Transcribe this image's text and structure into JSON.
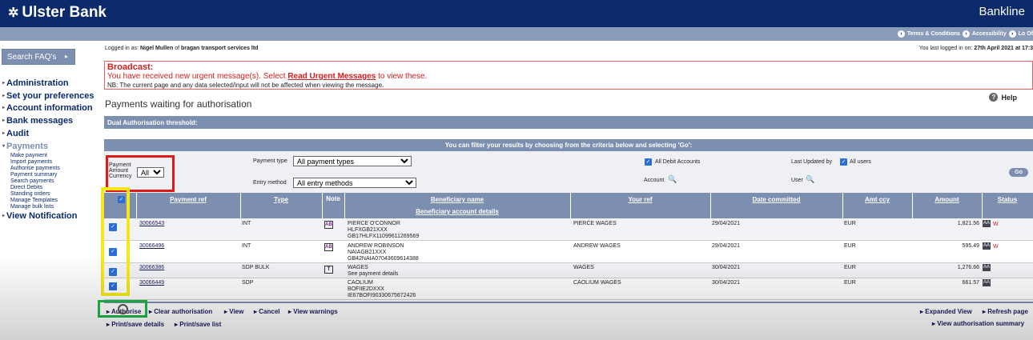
{
  "header": {
    "brand": "Ulster Bank",
    "product": "Bankline"
  },
  "top_links": [
    "Terms & Conditions",
    "Accessibility",
    "Lo Of"
  ],
  "sidebar": {
    "faq_label": "Search FAQ's",
    "items": [
      {
        "label": "Administration"
      },
      {
        "label": "Set your preferences"
      },
      {
        "label": "Account information"
      },
      {
        "label": "Bank messages"
      },
      {
        "label": "Audit"
      },
      {
        "label": "Payments"
      }
    ],
    "payments_sub": [
      "Make payment",
      "Import payments",
      "Authorise payments",
      "Payment summary",
      "Search payments",
      "Direct Debits",
      "Standing orders",
      "Manage Templates",
      "Manage bulk lists"
    ],
    "view_notification": "View Notification"
  },
  "session": {
    "logged_prefix": "Logged in as:",
    "user": "Nigel Mullen",
    "of_text": "of",
    "company": "bragan transport services ltd",
    "last_prefix": "You last logged in on:",
    "last_time": "27th April 2021 at 17:3"
  },
  "broadcast": {
    "title": "Broadcast:",
    "msg_pre": "You have received new urgent message(s). Select",
    "msg_link": "Read Urgent Messages",
    "msg_post": "to view these.",
    "nb": "NB: The current page and any data selected/input will not be affected when viewing the message."
  },
  "page": {
    "title": "Payments waiting for authorisation",
    "help": "Help"
  },
  "dual_threshold": "Dual Authorisation threshold:",
  "filter_bar": "You can filter your results by choosing from the criteria below and selecting 'Go':",
  "filters": {
    "amount_currency_label_1": "Payment",
    "amount_currency_label_2": "Amount",
    "amount_currency_label_3": "Currency",
    "amount_currency_value": "All",
    "payment_type_label": "Payment type",
    "payment_type_value": "All payment types",
    "entry_method_label": "Entry method",
    "entry_method_value": "All entry methods",
    "all_debit_accounts": "All Debit Accounts",
    "account_label": "Account",
    "last_updated_label": "Last Updated by",
    "all_users": "All users",
    "user_label": "User",
    "go": "Go"
  },
  "table": {
    "headers": {
      "payment_ref": "Payment ref",
      "type": "Type",
      "note": "Note",
      "beneficiary": "Beneficiary name",
      "beneficiary_details": "Beneficiary account details",
      "your_ref": "Your ref",
      "date": "Date committed",
      "amt_ccy": "Amt ccy",
      "amount": "Amount",
      "status": "Status"
    },
    "rows": [
      {
        "ref": "30066543",
        "type": "INT",
        "note": "AB",
        "ben1": "PIERCE O'CONNOR",
        "ben2": "HLFXGB21XXX",
        "ben3": "GB17HLFX11099611269569",
        "your_ref": "PIERCE WAGES",
        "date": "29/04/2021",
        "ccy": "EUR",
        "amount": "1,821.56",
        "status": "AA",
        "warn": "W"
      },
      {
        "ref": "30066496",
        "type": "INT",
        "note": "AB",
        "ben1": "ANDREW ROBINSON",
        "ben2": "NAIAGB21XXX",
        "ben3": "GB42NAIA07043609614388",
        "your_ref": "ANDREW WAGES",
        "date": "29/04/2021",
        "ccy": "EUR",
        "amount": "595.49",
        "status": "AA",
        "warn": "W"
      },
      {
        "ref": "30066386",
        "type": "SDP BULK",
        "note": "T",
        "ben1": "WAGES",
        "ben2": "See payment details",
        "ben3": "",
        "your_ref": "WAGES",
        "date": "30/04/2021",
        "ccy": "EUR",
        "amount": "1,276.66",
        "status": "AA",
        "warn": ""
      },
      {
        "ref": "30066449",
        "type": "SDP",
        "note": "",
        "ben1": "CAOLIUM",
        "ben2": "BOFIIE2DXXX",
        "ben3": "IE67BOFI90330675672426",
        "your_ref": "CAOLIUM WAGES",
        "date": "30/04/2021",
        "ccy": "EUR",
        "amount": "661.57",
        "status": "AA",
        "warn": ""
      }
    ]
  },
  "actions": {
    "authorise": "Authorise",
    "clear": "Clear authorisation",
    "view": "View",
    "cancel": "Cancel",
    "view_warnings": "View warnings",
    "print_details": "Print/save details",
    "print_list": "Print/save list",
    "expanded_view": "Expanded View",
    "refresh": "Refresh page",
    "view_summary": "View authorisation summary"
  }
}
